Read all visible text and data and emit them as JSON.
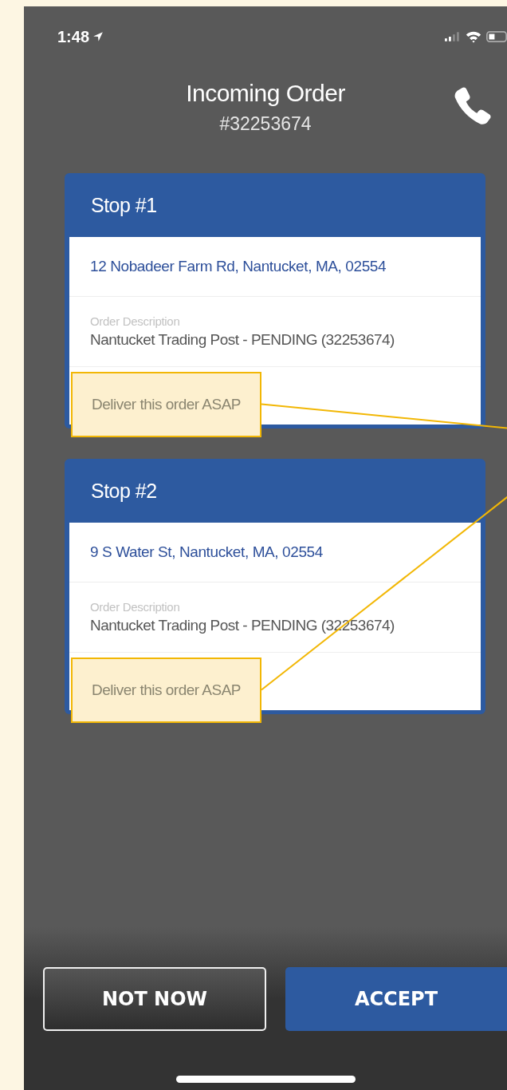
{
  "status_bar": {
    "time": "1:48"
  },
  "header": {
    "title": "Incoming Order",
    "order_number": "#32253674"
  },
  "stops": [
    {
      "title": "Stop #1",
      "address": "12 Nobadeer Farm Rd, Nantucket, MA, 02554",
      "description_label": "Order Description",
      "description": "Nantucket Trading Post - PENDING (32253674)",
      "note": "Deliver this order ASAP",
      "highlighted": true
    },
    {
      "title": "Stop #2",
      "address": "9 S Water St, Nantucket, MA, 02554",
      "description_label": "Order Description",
      "description": "Nantucket Trading Post - PENDING (32253674)",
      "note": "Deliver this order ASAP",
      "highlighted": true
    }
  ],
  "buttons": [
    {
      "label": "NOT NOW",
      "kind": "secondary"
    },
    {
      "label": "ACCEPT",
      "kind": "primary"
    }
  ]
}
